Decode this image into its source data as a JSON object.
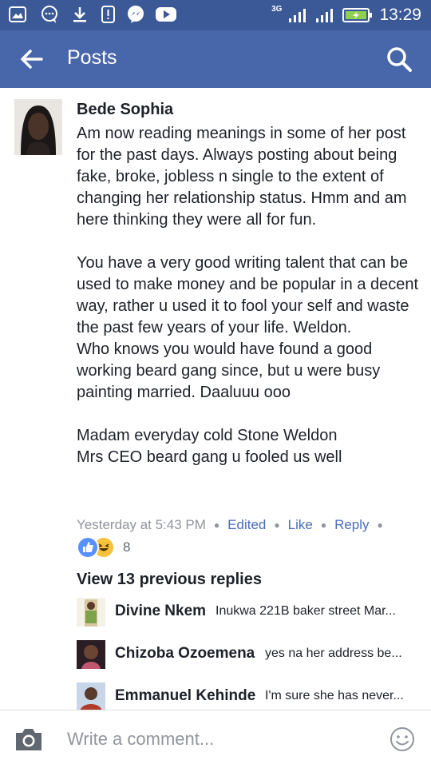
{
  "status_bar": {
    "network": "3G",
    "time": "13:29",
    "icons": [
      "gallery-icon",
      "chat-icon",
      "download-icon",
      "notification-icon",
      "messenger-icon",
      "youtube-icon",
      "signal-icon",
      "battery-icon"
    ]
  },
  "header": {
    "title": "Posts",
    "back_icon": "arrow-left-icon",
    "search_icon": "search-icon",
    "color": "#4867aa"
  },
  "comment": {
    "author": "Bede Sophia",
    "text": "Am now reading meanings in some of her post for the past days. Always posting about being fake, broke, jobless n single to the extent of changing her relationship status. Hmm and am here thinking they were all for fun.\n\nYou have a very good writing talent that can be used to make money and be popular in a decent way, rather u used it to fool your self and waste the past few years of your life. Weldon.\nWho knows you would have found a good working beard gang since, but u were busy painting married. Daaluuu ooo\n\nMadam everyday cold Stone Weldon\nMrs CEO beard gang u fooled us well",
    "timestamp": "Yesterday at 5:43 PM",
    "edited_label": "Edited",
    "like_label": "Like",
    "reply_label": "Reply",
    "reaction_count": "8"
  },
  "replies_section": {
    "view_previous_label": "View 13 previous replies",
    "replies": [
      {
        "name": "Divine Nkem",
        "text": "Inukwa 221B baker street Mar..."
      },
      {
        "name": "Chizoba Ozoemena",
        "text": "yes na her address be..."
      },
      {
        "name": "Emmanuel Kehinde",
        "text": "I'm sure she has never..."
      }
    ]
  },
  "composer": {
    "placeholder": "Write a comment...",
    "camera_icon": "camera-icon",
    "emoji_icon": "smiley-icon"
  }
}
